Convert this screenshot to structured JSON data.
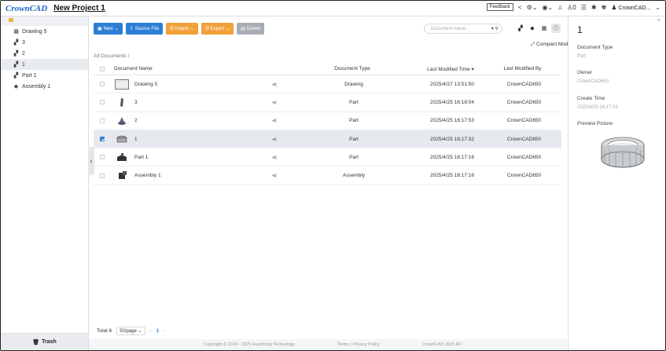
{
  "header": {
    "logo_first": "C",
    "logo_rest": "rownCAD",
    "project_title": "New Project 1",
    "feedback": "Feedback",
    "notifications_count": "0",
    "user_name": "CrownCAD..."
  },
  "sidebar": {
    "items": [
      {
        "icon": "drawing-icon",
        "label": "Drawing 5"
      },
      {
        "icon": "part-icon",
        "label": "3"
      },
      {
        "icon": "part-icon",
        "label": "2"
      },
      {
        "icon": "part-icon",
        "label": "1"
      },
      {
        "icon": "part-icon",
        "label": "Part 1"
      },
      {
        "icon": "assembly-icon",
        "label": "Assembly 1"
      }
    ],
    "trash_label": "Trash"
  },
  "toolbar": {
    "new_label": "New",
    "source_file_label": "Source File",
    "import_label": "Import",
    "export_label": "Export",
    "delete_label": "Delete"
  },
  "search": {
    "placeholder": "Document name..."
  },
  "compact_mode_label": "Compact Mode",
  "breadcrumb": {
    "root": "All Documents",
    "separator": "/"
  },
  "table": {
    "columns": {
      "name": "Document Name",
      "type": "Document Type",
      "time": "Last Modified Time",
      "by": "Last Modified By"
    },
    "rows": [
      {
        "name": "Drawing 5",
        "type": "Drawing",
        "time": "2025/4/27 13:51:50",
        "by": "CrownCAD650",
        "checked": false
      },
      {
        "name": "3",
        "type": "Part",
        "time": "2025/4/25 16:18:04",
        "by": "CrownCAD650",
        "checked": false
      },
      {
        "name": "2",
        "type": "Part",
        "time": "2025/4/25 16:17:53",
        "by": "CrownCAD650",
        "checked": false
      },
      {
        "name": "1",
        "type": "Part",
        "time": "2025/4/25 16:17:32",
        "by": "CrownCAD650",
        "checked": true
      },
      {
        "name": "Part 1",
        "type": "Part",
        "time": "2025/4/25 16:17:16",
        "by": "CrownCAD650",
        "checked": false
      },
      {
        "name": "Assembly 1",
        "type": "Assembly",
        "time": "2025/4/25 16:17:16",
        "by": "CrownCAD650",
        "checked": false
      }
    ]
  },
  "pagination": {
    "total": "Total 6",
    "page_size": "50/page",
    "current_page": "1"
  },
  "footer": {
    "copyright": "Copyright © 2019 - 2025 Huazhong Technology",
    "links": "Terms | Privacy Policy",
    "version": "CrownCAD 2025.R2"
  },
  "details": {
    "title": "1",
    "doc_type_label": "Document Type",
    "doc_type_value": "Part",
    "owner_label": "Owner",
    "owner_value": "CrownCAD650",
    "create_label": "Create Time",
    "create_value": "2025/4/25 16:17:32",
    "preview_label": "Preview Picture"
  },
  "colors": {
    "primary": "#2d7fd6",
    "warning": "#f0a13a",
    "disabled": "#a8adb4"
  }
}
